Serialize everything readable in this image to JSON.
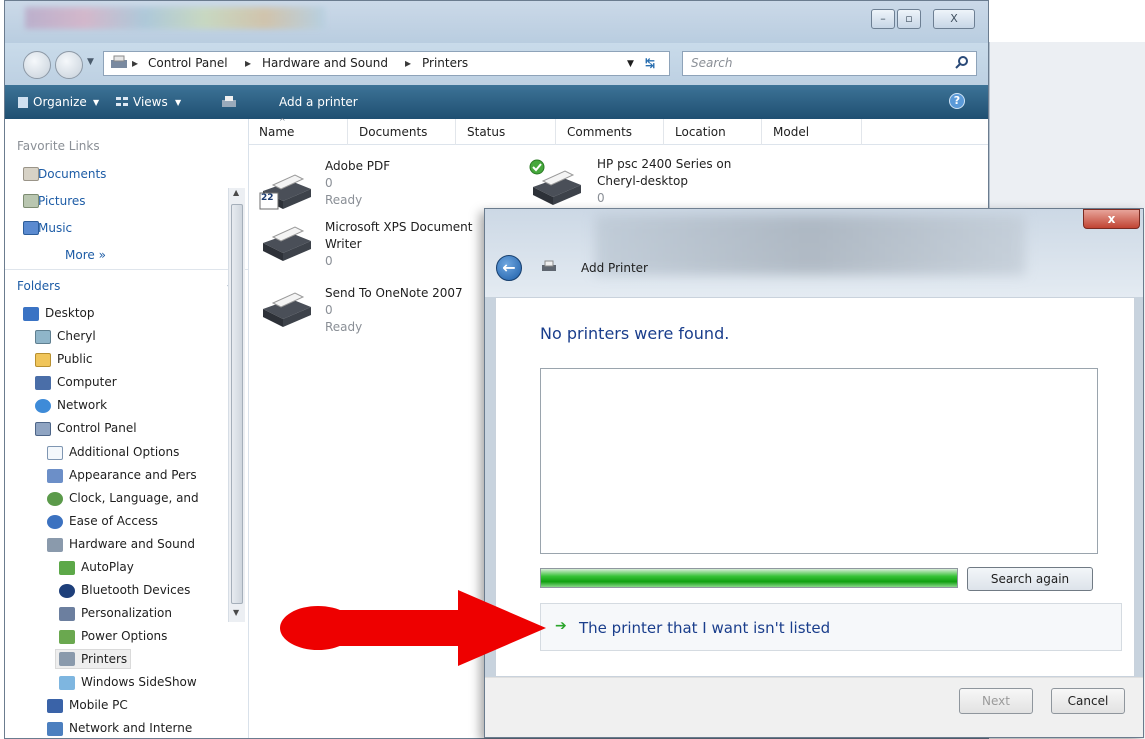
{
  "explorer": {
    "address_crumbs": [
      "Control Panel",
      "Hardware and Sound",
      "Printers"
    ],
    "search_placeholder": "Search",
    "toolbar": {
      "organize": "Organize",
      "views": "Views",
      "add_printer": "Add a printer"
    },
    "favorite_links": {
      "header": "Favorite Links",
      "items": [
        "Documents",
        "Pictures",
        "Music"
      ],
      "more": "More »"
    },
    "folders": {
      "header": "Folders",
      "items": [
        "Desktop",
        "Cheryl",
        "Public",
        "Computer",
        "Network",
        "Control Panel",
        "Additional Options",
        "Appearance and Pers",
        "Clock, Language, and",
        "Ease of Access",
        "Hardware and Sound",
        "AutoPlay",
        "Bluetooth Devices",
        "Personalization",
        "Power Options",
        "Printers",
        "Windows SideShow",
        "Mobile PC",
        "Network and Interne"
      ]
    },
    "columns": [
      "Name",
      "Documents",
      "Status",
      "Comments",
      "Location",
      "Model"
    ],
    "printers": [
      {
        "name": "Adobe PDF",
        "docs": "0",
        "status": "Ready"
      },
      {
        "name": "HP psc 2400 Series on",
        "name2": "Cheryl-desktop",
        "docs": "0"
      },
      {
        "name": "Microsoft XPS Document",
        "name2": "Writer",
        "docs": "0"
      },
      {
        "name": "Send To OneNote 2007",
        "docs": "0",
        "status": "Ready"
      }
    ],
    "icon_badge": "22"
  },
  "dialog": {
    "title": "Add Printer",
    "close": "x",
    "heading": "No printers were found.",
    "search_again": "Search again",
    "not_listed": "The printer that I want isn't listed",
    "next": "Next",
    "cancel": "Cancel",
    "search_progress": 0.97
  },
  "colors": {
    "toolbar": "#1f4f71",
    "link": "#1a3e8c",
    "progress": "#1fae1f",
    "arrow": "#ee0000"
  }
}
